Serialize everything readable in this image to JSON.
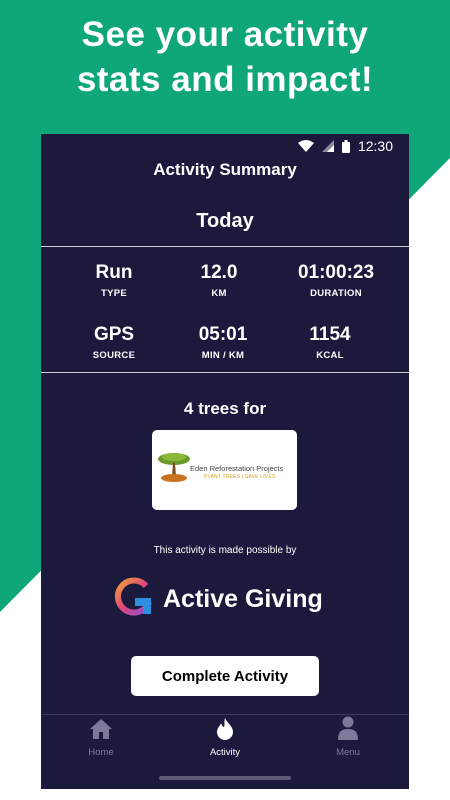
{
  "headline": {
    "line1": "See your activity",
    "line2": "stats and impact!"
  },
  "status_bar": {
    "time": "12:30",
    "icons": [
      "wifi-icon",
      "signal-icon",
      "battery-icon"
    ]
  },
  "app_bar": {
    "title": "Activity Summary"
  },
  "section": {
    "title": "Today"
  },
  "stats": [
    {
      "value": "Run",
      "label": "TYPE"
    },
    {
      "value": "12.0",
      "label": "KM"
    },
    {
      "value": "01:00:23",
      "label": "DURATION"
    },
    {
      "value": "GPS",
      "label": "SOURCE"
    },
    {
      "value": "05:01",
      "label": "MIN / KM"
    },
    {
      "value": "1154",
      "label": "KCAL"
    }
  ],
  "impact": {
    "title": "4 trees for",
    "partner_name": "Eden Reforestation Projects",
    "partner_tagline": "PLANT TREES | SAVE LIVES"
  },
  "sponsor": {
    "caption": "This activity is made possible by",
    "brand": "Active Giving"
  },
  "complete_button": {
    "label": "Complete Activity"
  },
  "bottom_nav": [
    {
      "label": "Home",
      "icon": "home-icon"
    },
    {
      "label": "Activity",
      "icon": "flame-icon"
    },
    {
      "label": "Menu",
      "icon": "person-icon"
    }
  ],
  "colors": {
    "brand_green": "#0fa67a",
    "screen_background": "#1b1a3d",
    "nav_inactive": "#7b7a98"
  }
}
